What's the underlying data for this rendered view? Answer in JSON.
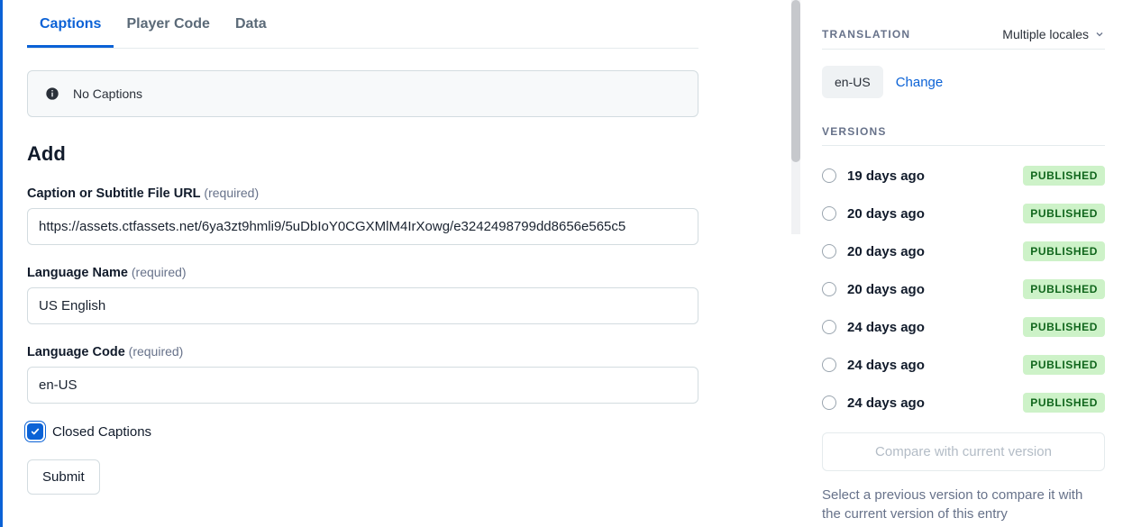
{
  "tabs": {
    "captions": "Captions",
    "player_code": "Player Code",
    "data": "Data"
  },
  "note": {
    "text": "No Captions"
  },
  "add": {
    "heading": "Add",
    "url_label": "Caption or Subtitle File URL",
    "url_req": "(required)",
    "url_value": "https://assets.ctfassets.net/6ya3zt9hmli9/5uDbIoY0CGXMlM4IrXowg/e3242498799dd8656e565c5",
    "lang_label": "Language Name",
    "lang_req": "(required)",
    "lang_value": "US English",
    "code_label": "Language Code",
    "code_req": "(required)",
    "code_value": "en-US",
    "cc_label": "Closed Captions",
    "submit": "Submit"
  },
  "sidebar": {
    "translation": {
      "heading": "TRANSLATION",
      "selector": "Multiple locales",
      "chip": "en-US",
      "change": "Change"
    },
    "versions": {
      "heading": "VERSIONS",
      "items": [
        {
          "time": "19 days ago",
          "status": "PUBLISHED"
        },
        {
          "time": "20 days ago",
          "status": "PUBLISHED"
        },
        {
          "time": "20 days ago",
          "status": "PUBLISHED"
        },
        {
          "time": "20 days ago",
          "status": "PUBLISHED"
        },
        {
          "time": "24 days ago",
          "status": "PUBLISHED"
        },
        {
          "time": "24 days ago",
          "status": "PUBLISHED"
        },
        {
          "time": "24 days ago",
          "status": "PUBLISHED"
        }
      ],
      "compare": "Compare with current version",
      "help": "Select a previous version to compare it with the current version of this entry"
    }
  }
}
